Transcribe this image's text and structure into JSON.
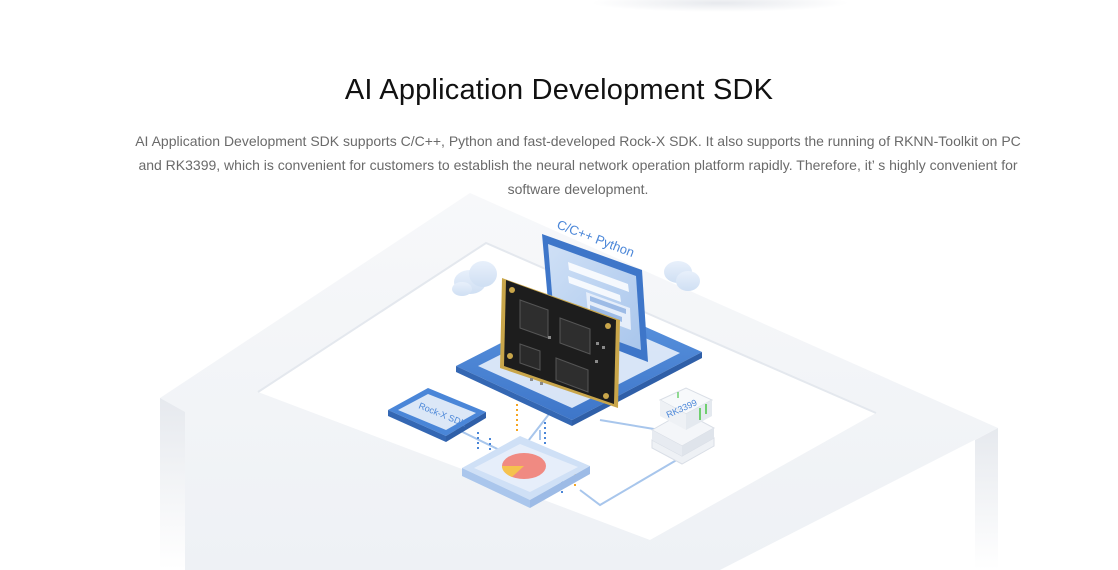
{
  "section": {
    "title": "AI Application Development SDK",
    "description": "AI Application Development SDK supports C/C++, Python and fast-developed Rock-X SDK. It also supports the running of RKNN-Toolkit on PC and RK3399, which is convenient for customers to establish the neural network operation platform rapidly. Therefore, it’ s highly convenient for software development."
  },
  "illustration": {
    "monitor_label": "C/C++  Python",
    "sdk_tile_label": "Rock-X SDK",
    "chip_label": "RK3399",
    "colors": {
      "accent_blue": "#4a86d8",
      "light_blue": "#b9d2f0",
      "platform": "#f3f5f8",
      "board": "#1d1d1d",
      "gold": "#c9a64a",
      "pie_red": "#f08a82",
      "pie_yellow": "#f5c24e"
    }
  }
}
